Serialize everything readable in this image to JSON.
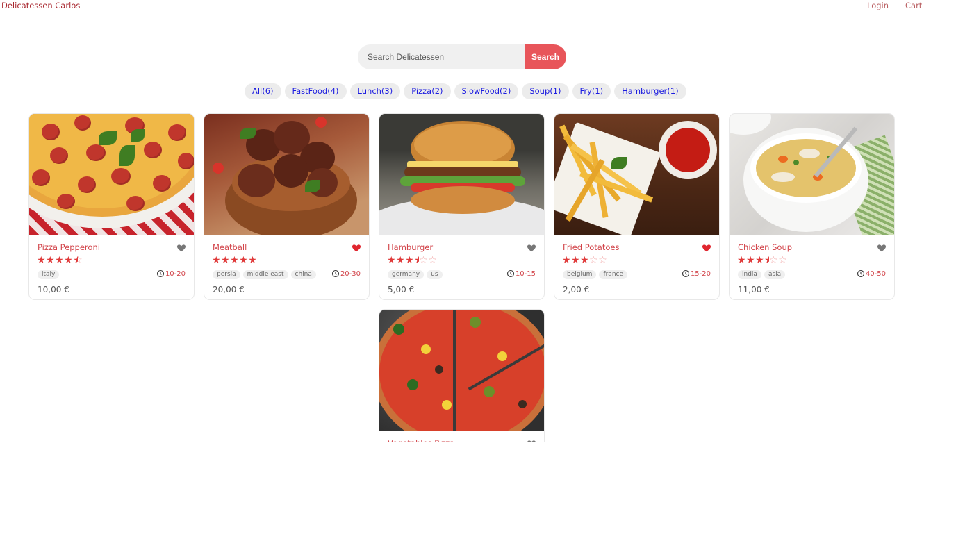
{
  "header": {
    "brand": "Delicatessen Carlos",
    "login": "Login",
    "cart": "Cart"
  },
  "search": {
    "placeholder": "Search Delicatessen",
    "button": "Search"
  },
  "tags": [
    "All(6)",
    "FastFood(4)",
    "Lunch(3)",
    "Pizza(2)",
    "SlowFood(2)",
    "Soup(1)",
    "Fry(1)",
    "Hamburger(1)"
  ],
  "foods": [
    {
      "name": "Pizza Pepperoni",
      "stars": 4.5,
      "favorite": false,
      "origins": [
        "italy"
      ],
      "time": "10-20",
      "price": "10,00 €",
      "image": "pepperoni-pizza-image"
    },
    {
      "name": "Meatball",
      "stars": 5,
      "favorite": true,
      "origins": [
        "persia",
        "middle east",
        "china"
      ],
      "time": "20-30",
      "price": "20,00 €",
      "image": "meatball-image"
    },
    {
      "name": "Hamburger",
      "stars": 3.5,
      "favorite": false,
      "origins": [
        "germany",
        "us"
      ],
      "time": "10-15",
      "price": "5,00 €",
      "image": "hamburger-image"
    },
    {
      "name": "Fried Potatoes",
      "stars": 3,
      "favorite": true,
      "origins": [
        "belgium",
        "france"
      ],
      "time": "15-20",
      "price": "2,00 €",
      "image": "fries-image"
    },
    {
      "name": "Chicken Soup",
      "stars": 3.5,
      "favorite": false,
      "origins": [
        "india",
        "asia"
      ],
      "time": "40-50",
      "price": "11,00 €",
      "image": "chicken-soup-image"
    },
    {
      "name": "Vegetables Pizza",
      "stars": null,
      "favorite": false,
      "origins": [],
      "time": "",
      "price": "",
      "image": "vegetable-pizza-image"
    }
  ],
  "colors": {
    "accent": "#e8555a",
    "name": "#d2444a",
    "tag_text": "#1c1ce0",
    "heart_fav": "#e0262f",
    "heart_off": "#777777"
  },
  "icons": {
    "favorite": "heart-icon",
    "time": "clock-icon",
    "rating": "star-icon"
  }
}
